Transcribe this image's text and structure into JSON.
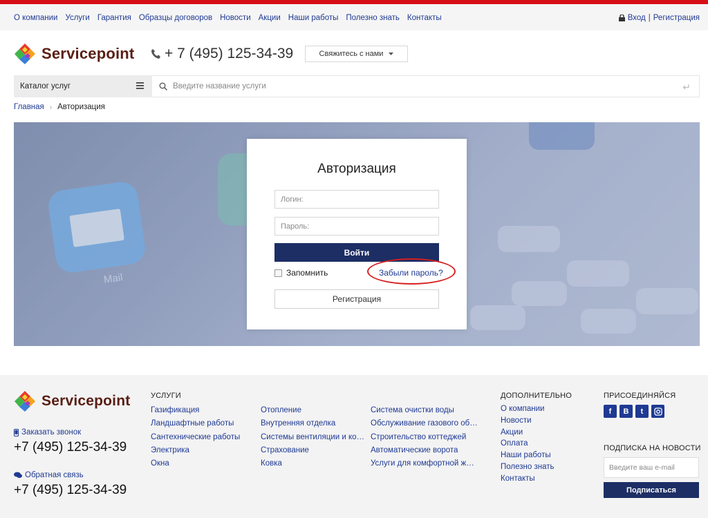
{
  "topnav": {
    "items": [
      "О компании",
      "Услуги",
      "Гарантия",
      "Образцы договоров",
      "Новости",
      "Акции",
      "Наши работы",
      "Полезно знать",
      "Контакты"
    ],
    "login": "Вход",
    "separator": "|",
    "register": "Регистрация"
  },
  "header": {
    "brand": "Servicepoint",
    "phone": "+ 7 (495) 125-34-39",
    "contact_button": "Свяжитесь с нами"
  },
  "catalog": {
    "label": "Каталог услуг"
  },
  "search": {
    "placeholder": "Введите название услуги"
  },
  "breadcrumb": {
    "home": "Главная",
    "current": "Авторизация"
  },
  "hero": {
    "mail_label": "Mail"
  },
  "login_form": {
    "title": "Авторизация",
    "login_placeholder": "Логин:",
    "password_placeholder": "Пароль:",
    "submit": "Войти",
    "remember": "Запомнить",
    "forgot": "Забыли пароль?",
    "register": "Регистрация"
  },
  "footer": {
    "brand": "Servicepoint",
    "order_call": "Заказать звонок",
    "phone1": "+7 (495) 125-34-39",
    "feedback": "Обратная связь",
    "phone2": "+7 (495) 125-34-39",
    "services_title": "УСЛУГИ",
    "services_col1": [
      "Газификация",
      "Ландшафтные работы",
      "Сантехнические работы",
      "Электрика",
      "Окна"
    ],
    "services_col2": [
      "Отопление",
      "Внутренняя отделка",
      "Системы вентиляции и кон…",
      "Страхование",
      "Ковка"
    ],
    "services_col3": [
      "Система очистки воды",
      "Обслуживание газового об…",
      "Строительство коттеджей",
      "Автоматические ворота",
      "Услуги для комфортной жиз…"
    ],
    "extra_title": "ДОПОЛНИТЕЛЬНО",
    "extra_items": [
      "О компании",
      "Новости",
      "Акции",
      "Оплата",
      "Наши работы",
      "Полезно знать",
      "Контакты"
    ],
    "join_title": "ПРИСОЕДИНЯЙСЯ",
    "social": [
      "f",
      "B",
      "t",
      "ig"
    ],
    "newsletter_title": "ПОДПИСКА НА НОВОСТИ",
    "email_placeholder": "Введите ваш e-mail",
    "subscribe": "Подписаться"
  },
  "colors": {
    "accent_red": "#d70f17",
    "brand_navy": "#1c2e64",
    "link_blue": "#1f3a93"
  }
}
